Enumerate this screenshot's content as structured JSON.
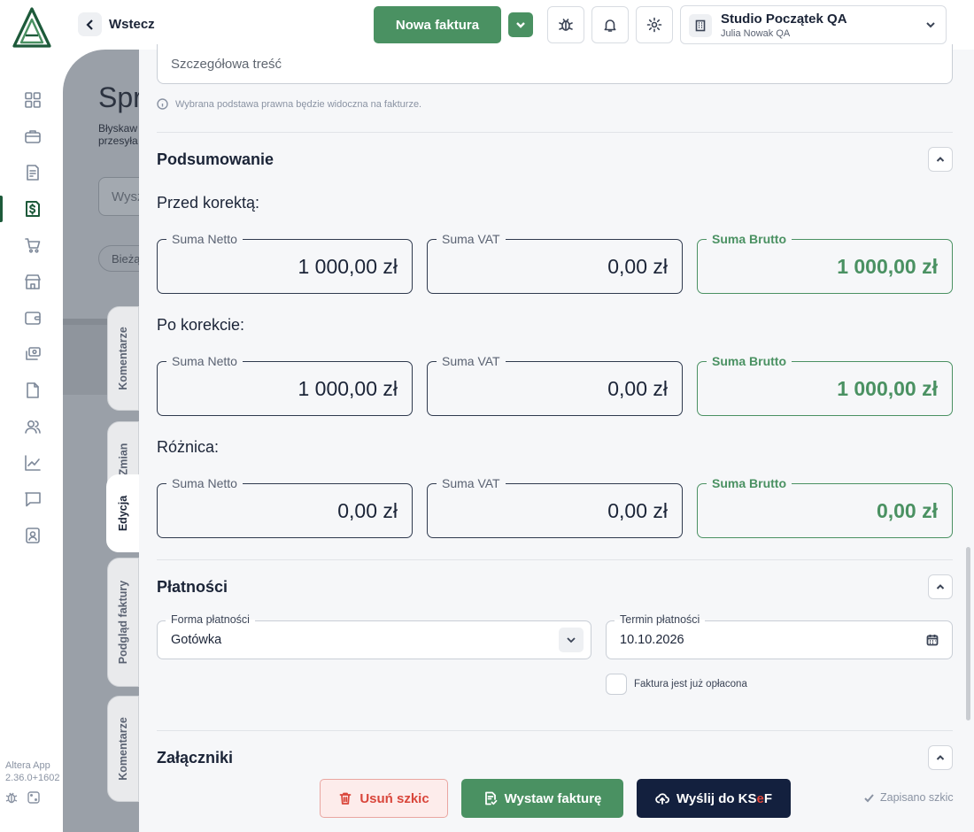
{
  "header": {
    "back_label": "Wstecz",
    "new_invoice_label": "Nowa faktura",
    "company_name": "Studio Początek QA",
    "company_user": "Julia Nowak QA"
  },
  "sidebar": {
    "items": [
      {
        "icon": "dashboard-icon"
      },
      {
        "icon": "briefcase-icon"
      },
      {
        "icon": "invoice-icon"
      },
      {
        "icon": "dollar-document-icon",
        "active": true
      },
      {
        "icon": "cart-icon"
      },
      {
        "icon": "store-icon"
      },
      {
        "icon": "wallet-icon"
      },
      {
        "icon": "money-transfer-icon"
      },
      {
        "icon": "file-icon"
      },
      {
        "icon": "users-icon"
      },
      {
        "icon": "chart-icon"
      },
      {
        "icon": "chat-icon"
      },
      {
        "icon": "contact-card-icon"
      }
    ],
    "app_name": "Altera App",
    "app_version": "2.36.0+1602"
  },
  "background": {
    "title": "Spr",
    "subtitle_line1": "Błyskaw",
    "subtitle_line2": "przesyła",
    "search_placeholder": "Wysz",
    "filter_pill": "Bieżą"
  },
  "vertical_tabs": {
    "comments_top": "Komentarze",
    "changes": "Zmian",
    "edit": "Edycja",
    "preview": "Podgląd faktury",
    "comments_bottom": "Komentarze"
  },
  "form": {
    "detail_placeholder": "Szczegółowa treść",
    "legal_hint": "Wybrana podstawa prawna będzie widoczna na fakturze."
  },
  "summary": {
    "title": "Podsumowanie",
    "before_label": "Przed korektą:",
    "after_label": "Po korekcie:",
    "diff_label": "Różnica:",
    "netto_label": "Suma Netto",
    "vat_label": "Suma VAT",
    "brutto_label": "Suma Brutto",
    "before": {
      "netto": "1 000,00 zł",
      "vat": "0,00 zł",
      "brutto": "1 000,00 zł"
    },
    "after": {
      "netto": "1 000,00 zł",
      "vat": "0,00 zł",
      "brutto": "1 000,00 zł"
    },
    "diff": {
      "netto": "0,00 zł",
      "vat": "0,00 zł",
      "brutto": "0,00 zł"
    }
  },
  "payments": {
    "title": "Płatności",
    "method_label": "Forma płatności",
    "method_value": "Gotówka",
    "due_label": "Termin płatności",
    "due_value": "10.10.2026",
    "paid_checkbox_label": "Faktura jest już opłacona"
  },
  "attachments": {
    "title": "Załączniki"
  },
  "footer": {
    "delete_label": "Usuń szkic",
    "issue_label": "Wystaw fakturę",
    "ksef_prefix": "Wyślij do KS",
    "ksef_e": "e",
    "ksef_suffix": "F",
    "saved_label": "Zapisano szkic"
  },
  "colors": {
    "primary_green": "#4a9162",
    "dark_navy": "#13203e",
    "danger": "#d9463b"
  }
}
